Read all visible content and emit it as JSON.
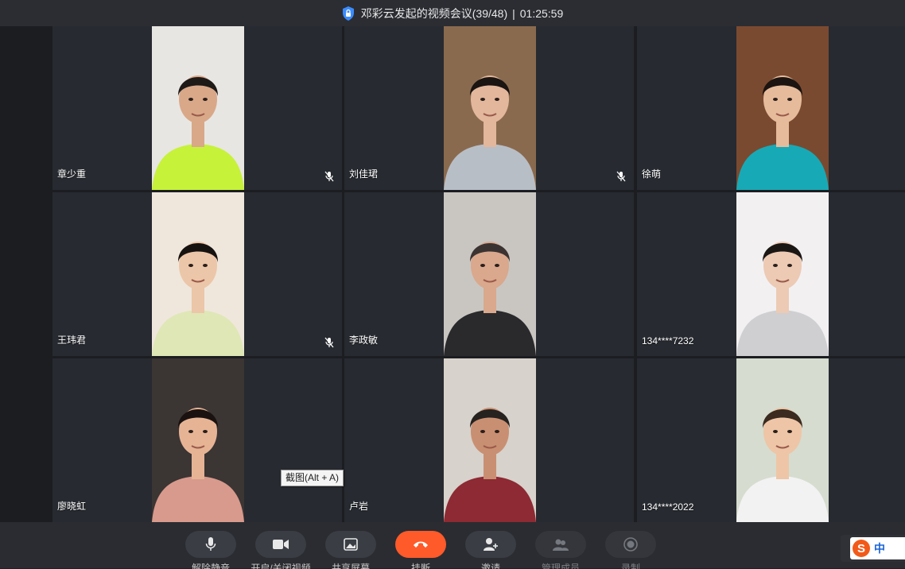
{
  "title": {
    "meeting": "邓彩云发起的视频会议(39/48)",
    "separator": "|",
    "elapsed": "01:25:59"
  },
  "participants": [
    {
      "name": "章少重",
      "muted": true,
      "skin": "#d9a889",
      "shirt": "#c6f23a",
      "bg": "#e8e6e2",
      "hair": "#1d1a18"
    },
    {
      "name": "刘佳珺",
      "muted": true,
      "skin": "#e2b79c",
      "shirt": "#b8bec6",
      "bg": "#8a6a4e",
      "hair": "#1a1412"
    },
    {
      "name": "徐萌",
      "muted": false,
      "skin": "#e6bb9c",
      "shirt": "#18a9b6",
      "bg": "#7a4a30",
      "hair": "#1c1410"
    },
    {
      "name": "王玮君",
      "muted": true,
      "skin": "#ecc6a8",
      "shirt": "#dfe7b6",
      "bg": "#efe7dc",
      "hair": "#161210"
    },
    {
      "name": "李政敏",
      "muted": false,
      "skin": "#d9a88d",
      "shirt": "#2a2a2c",
      "bg": "#c9c6c2",
      "hair": "#3a3332"
    },
    {
      "name": "134****7232",
      "muted": false,
      "skin": "#eccab4",
      "shirt": "#cfcfd2",
      "bg": "#f3f0f2",
      "hair": "#1a1614"
    },
    {
      "name": "廖晓虹",
      "muted": false,
      "skin": "#e6b495",
      "shirt": "#d89a8c",
      "bg": "#3b3534",
      "hair": "#1a1210"
    },
    {
      "name": "卢岩",
      "muted": false,
      "skin": "#c98f72",
      "shirt": "#8d2a33",
      "bg": "#d7d2cb",
      "hair": "#252220"
    },
    {
      "name": "134****2022",
      "muted": false,
      "skin": "#eec5a6",
      "shirt": "#f2f2f2",
      "bg": "#d6dccf",
      "hair": "#3a2a20"
    }
  ],
  "toolbar": [
    {
      "id": "mute",
      "label": "解除静音",
      "icon": "microphone-icon"
    },
    {
      "id": "video",
      "label": "开启/关闭视频",
      "icon": "video-camera-icon"
    },
    {
      "id": "share",
      "label": "共享屏幕",
      "icon": "screen-share-icon"
    },
    {
      "id": "leave",
      "label": "挂断",
      "icon": "hang-up-icon"
    },
    {
      "id": "invite",
      "label": "邀请",
      "icon": "add-user-icon"
    },
    {
      "id": "manage",
      "label": "管理成员",
      "icon": "members-icon"
    },
    {
      "id": "record",
      "label": "录制",
      "icon": "record-icon"
    }
  ],
  "tooltip": "截图(Alt + A)",
  "ime": {
    "logo": "S",
    "mode": "中"
  },
  "colors": {
    "leave": "#ff5a2a",
    "accent": "#3b8cff"
  }
}
